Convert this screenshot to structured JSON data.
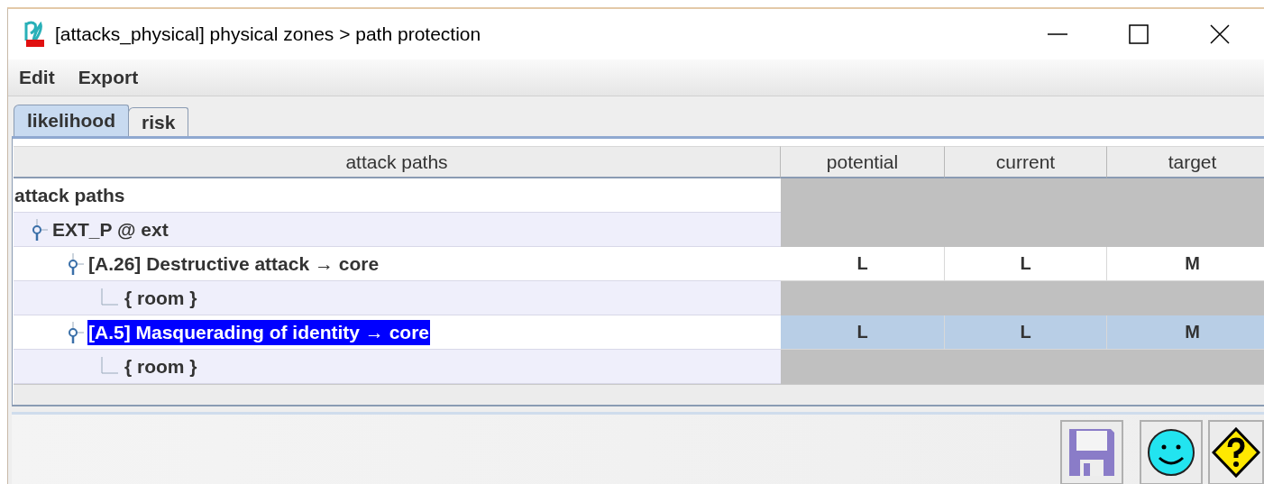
{
  "window": {
    "title": "[attacks_physical] physical zones > path protection"
  },
  "menu": [
    "Edit",
    "Export"
  ],
  "tabs": [
    {
      "label": "likelihood",
      "selected": true
    },
    {
      "label": "risk",
      "selected": false
    }
  ],
  "table": {
    "columns": [
      "attack paths",
      "potential",
      "current",
      "target"
    ],
    "rows": [
      {
        "label": "attack paths",
        "selected": false,
        "children": [
          {
            "label": "EXT_P @ ext",
            "selected": false,
            "expanded": true,
            "children": [
              {
                "label": "[A.26] Destructive attack → core",
                "selected": false,
                "expanded": true,
                "values": [
                  "L",
                  "L",
                  "M"
                ],
                "children": [
                  {
                    "label": "{ room }",
                    "selected": false
                  }
                ]
              },
              {
                "label": "[A.5] Masquerading of identity → core",
                "selected": true,
                "expanded": true,
                "values": [
                  "L",
                  "L",
                  "M"
                ],
                "children": [
                  {
                    "label": "{ room }",
                    "selected": false
                  }
                ]
              }
            ]
          }
        ]
      }
    ]
  }
}
